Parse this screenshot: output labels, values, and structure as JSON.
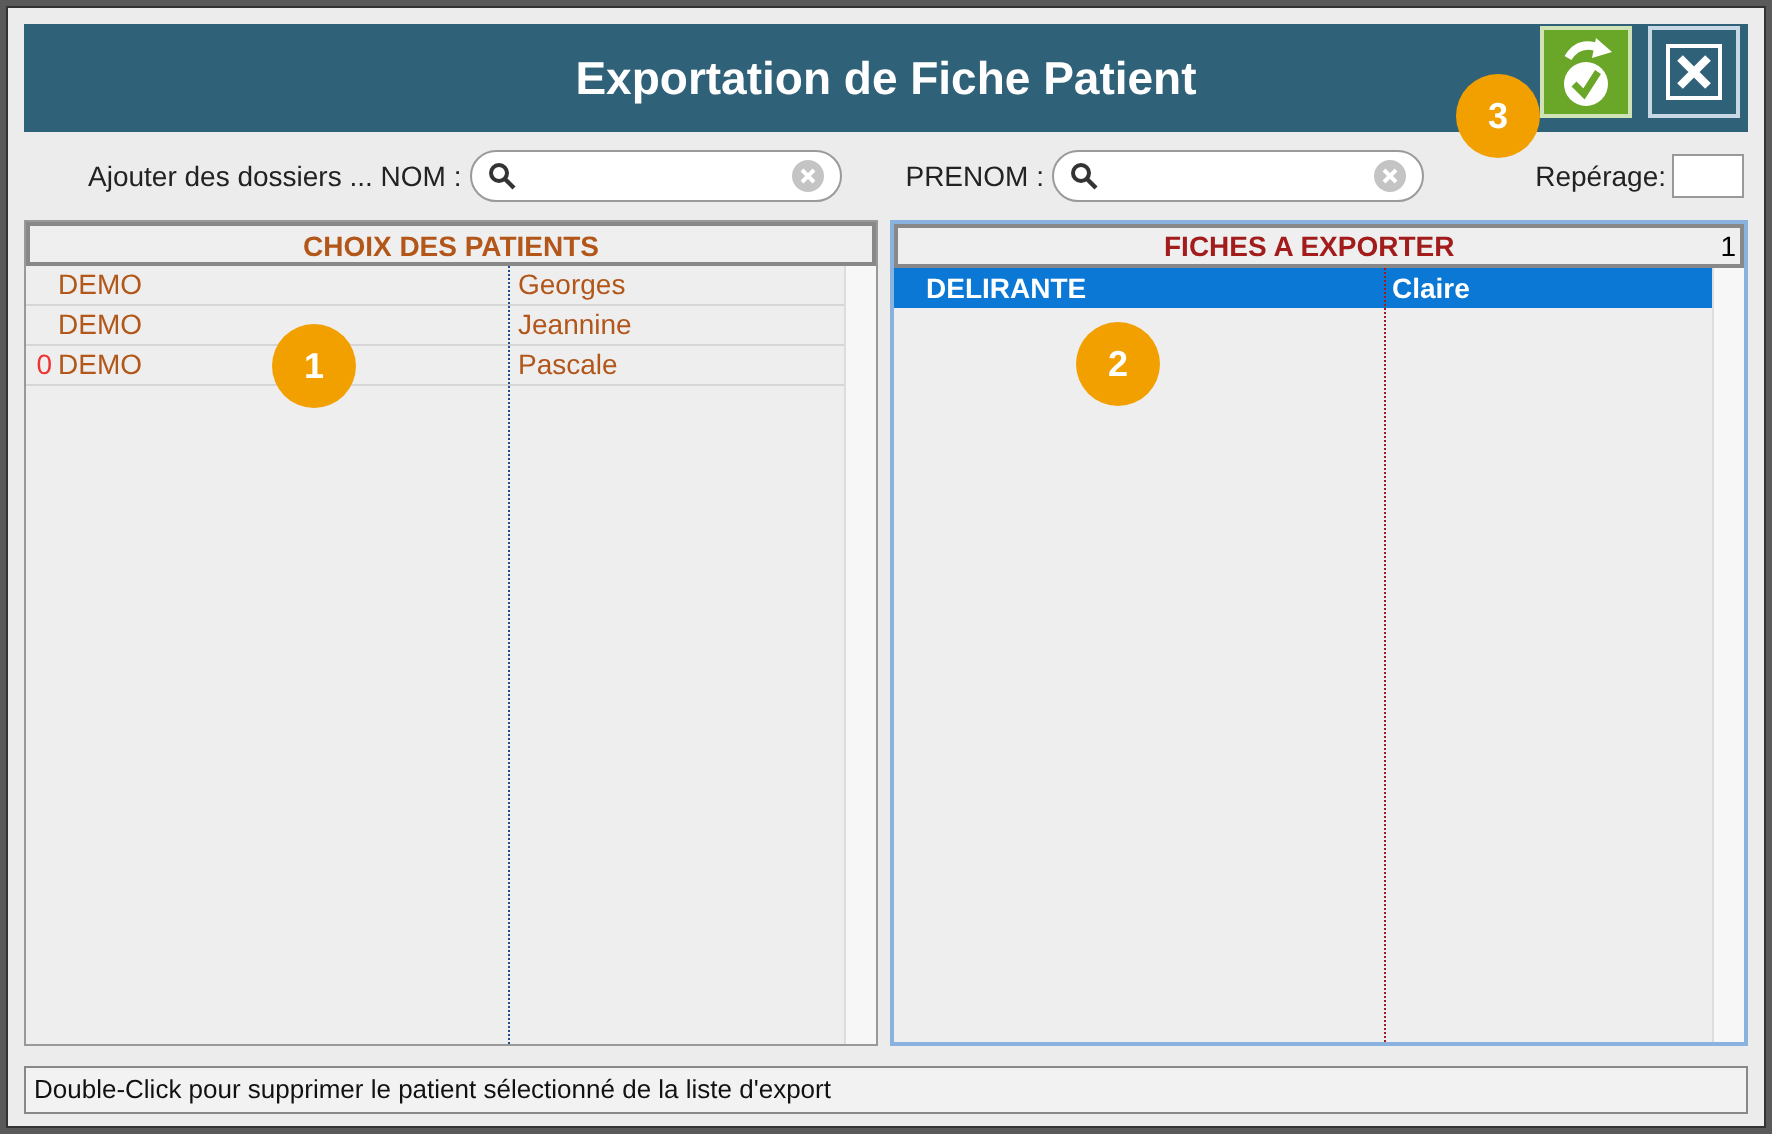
{
  "window": {
    "title": "Exportation de Fiche Patient"
  },
  "search": {
    "label": "Ajouter des dossiers ... NOM :",
    "prenom_label": "PRENOM :",
    "reperage_label": "Repérage:"
  },
  "left_list": {
    "title": "CHOIX DES PATIENTS",
    "rows": [
      {
        "marker": "",
        "nom": "DEMO",
        "prenom": "Georges",
        "selected": false
      },
      {
        "marker": "",
        "nom": "DEMO",
        "prenom": "Jeannine",
        "selected": false
      },
      {
        "marker": "0",
        "nom": "DEMO",
        "prenom": "Pascale",
        "selected": false
      }
    ]
  },
  "right_list": {
    "title": "FICHES A EXPORTER",
    "count": "1",
    "rows": [
      {
        "nom": "DELIRANTE",
        "prenom": "Claire",
        "selected": true
      }
    ]
  },
  "status_bar": "Double-Click pour supprimer le patient sélectionné de la liste d'export",
  "callouts": [
    "1",
    "2",
    "3"
  ]
}
